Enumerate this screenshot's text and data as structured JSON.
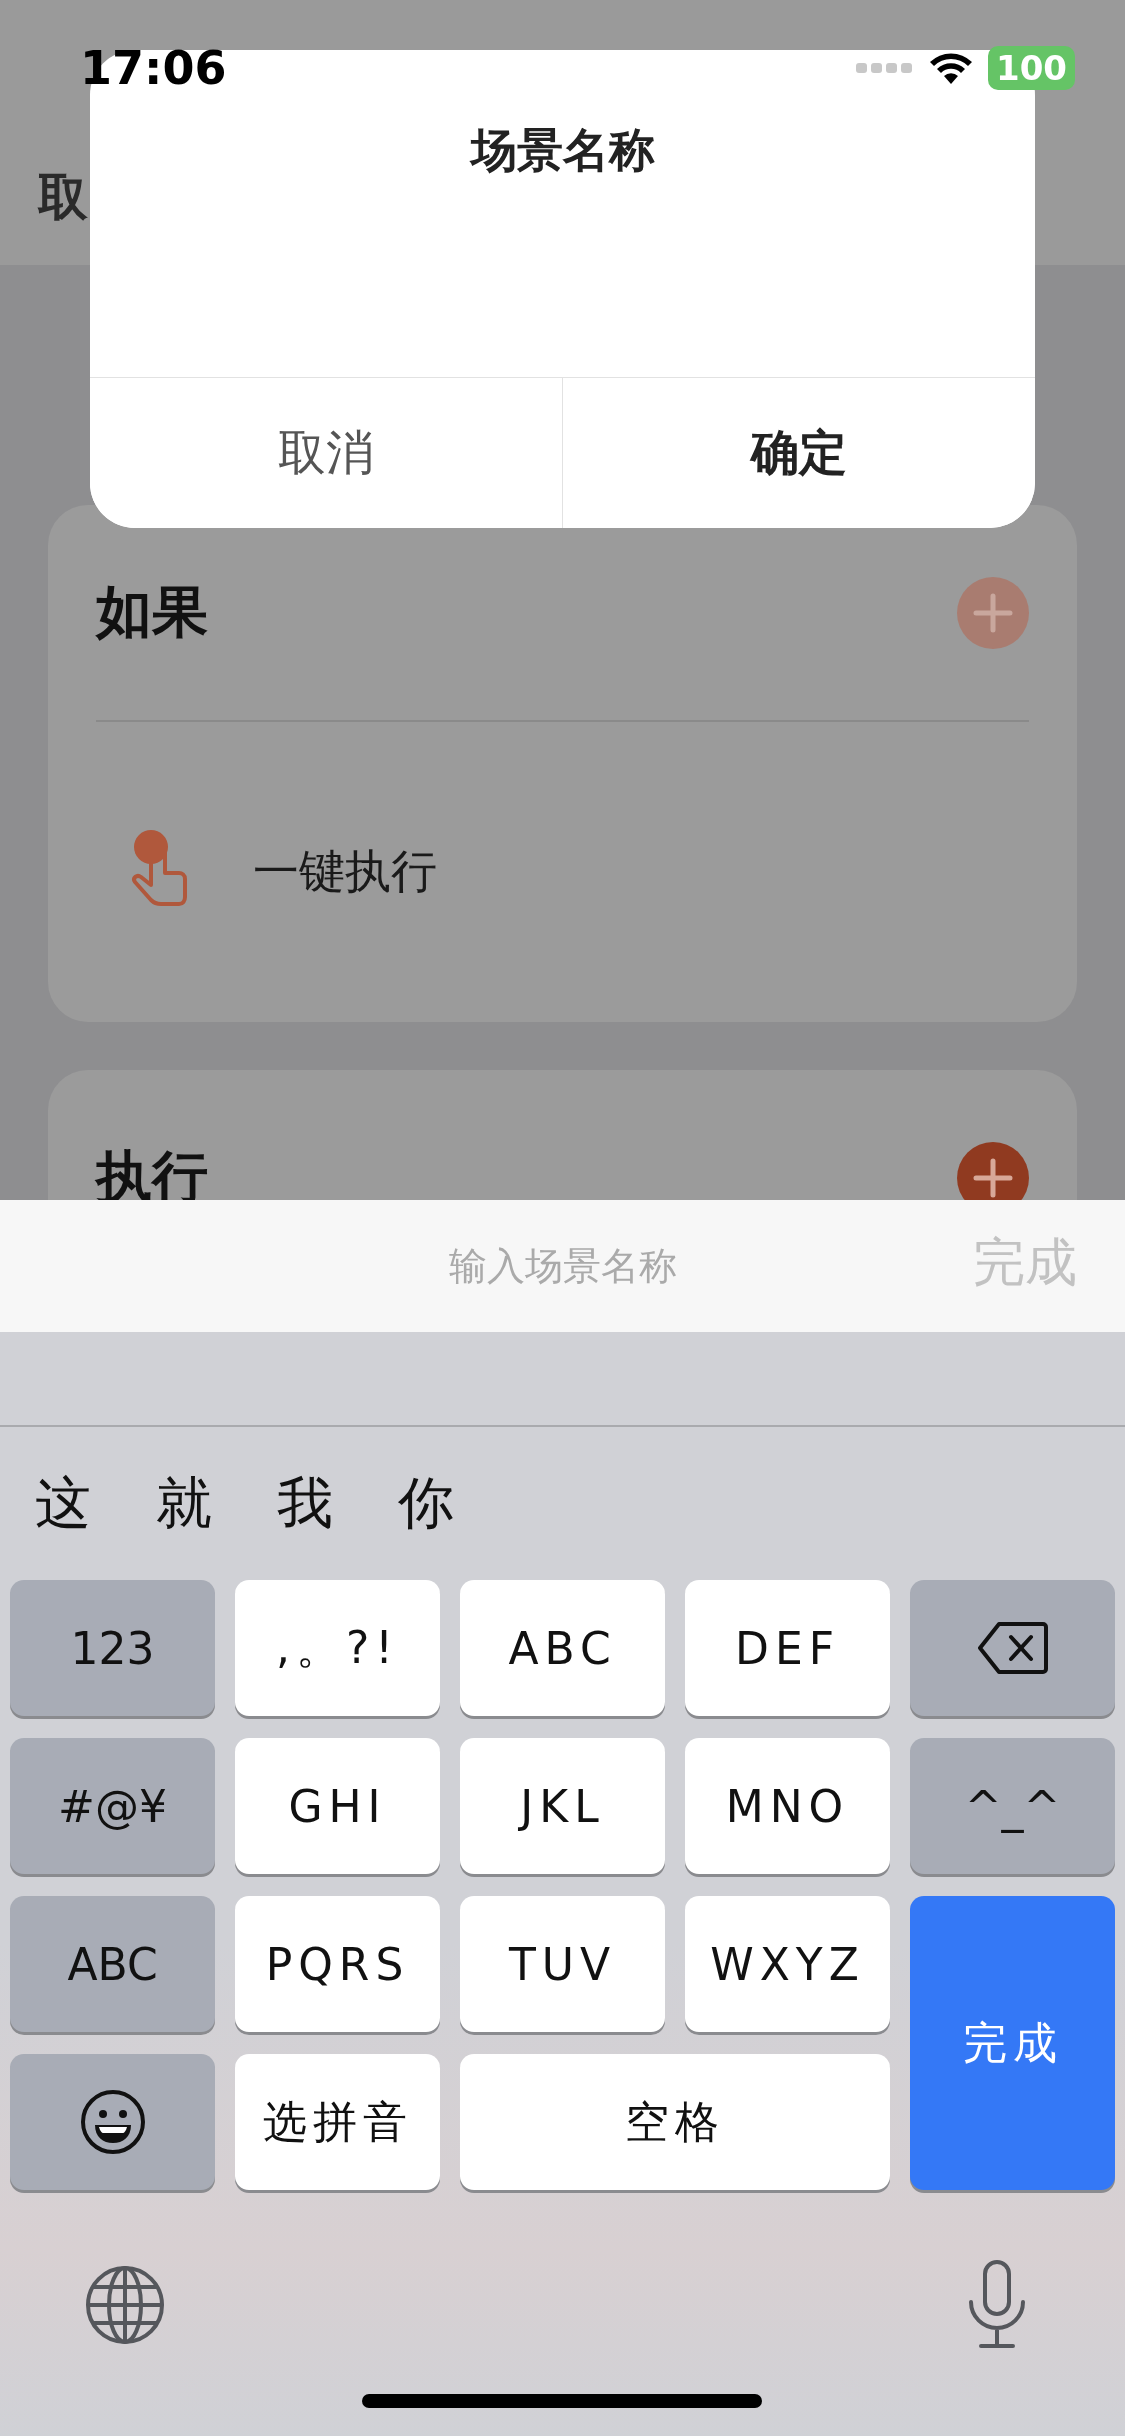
{
  "status_bar": {
    "time": "17:06",
    "battery": "100"
  },
  "nav": {
    "cancel": "取"
  },
  "sections": [
    {
      "title": "如果",
      "add_disabled": true,
      "items": [
        {
          "label": "一键执行"
        }
      ]
    },
    {
      "title": "执行",
      "add_disabled": false
    }
  ],
  "dialog": {
    "title": "场景名称",
    "buttons": [
      {
        "label": "取消",
        "kind": "cancel"
      },
      {
        "label": "确定",
        "kind": "confirm"
      }
    ]
  },
  "input_bar": {
    "placeholder": "输入场景名称",
    "done": "完成"
  },
  "keyboard": {
    "candidates": [
      "这",
      "就",
      "我",
      "你"
    ],
    "keys": [
      {
        "label": "123",
        "kind": "function"
      },
      {
        "label": ",。?!",
        "kind": "letter"
      },
      {
        "label": "ABC",
        "kind": "letter"
      },
      {
        "label": "DEF",
        "kind": "letter"
      },
      {
        "kind": "delete"
      },
      {
        "label": "#@¥",
        "kind": "function"
      },
      {
        "label": "GHI",
        "kind": "letter"
      },
      {
        "label": "JKL",
        "kind": "letter"
      },
      {
        "label": "MNO",
        "kind": "letter"
      },
      {
        "label": "^_^",
        "kind": "function"
      },
      {
        "label": "ABC",
        "kind": "function"
      },
      {
        "label": "PQRS",
        "kind": "letter"
      },
      {
        "label": "TUV",
        "kind": "letter"
      },
      {
        "label": "WXYZ",
        "kind": "letter"
      },
      {
        "label": "完成",
        "kind": "return"
      },
      {
        "kind": "emoji"
      },
      {
        "label": "选拼音",
        "kind": "letter"
      },
      {
        "label": "空格",
        "kind": "space"
      }
    ]
  }
}
